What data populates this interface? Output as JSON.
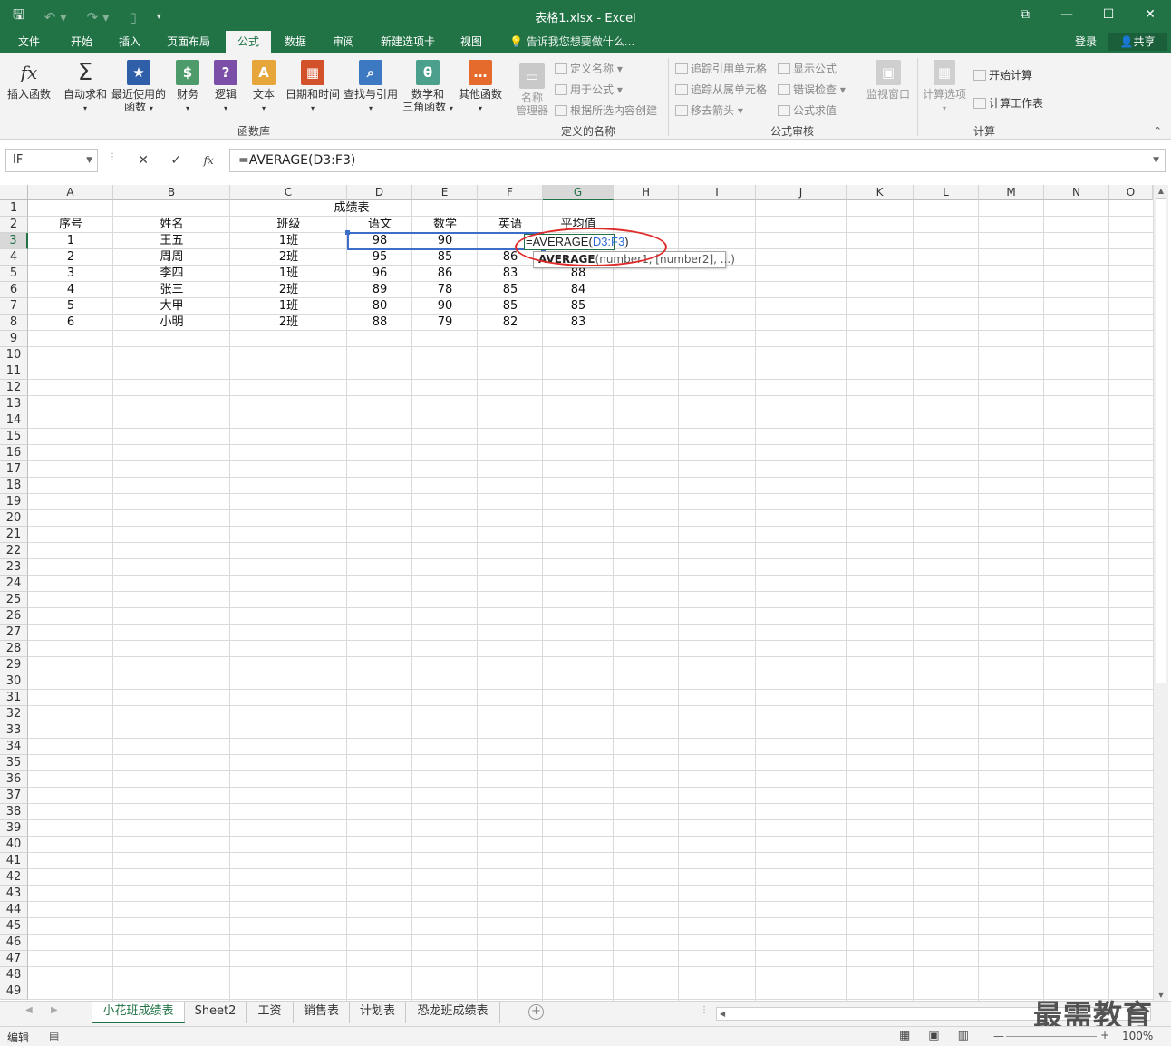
{
  "window": {
    "title": "表格1.xlsx - Excel",
    "qat_icons": [
      "save-icon",
      "undo-icon",
      "redo-icon",
      "new-icon",
      "customize-icon"
    ]
  },
  "tabs": [
    {
      "label": "文件",
      "x": 0
    },
    {
      "label": "开始"
    },
    {
      "label": "插入"
    },
    {
      "label": "页面布局"
    },
    {
      "label": "公式",
      "active": true
    },
    {
      "label": "数据"
    },
    {
      "label": "审阅"
    },
    {
      "label": "新建选项卡"
    },
    {
      "label": "视图"
    }
  ],
  "tell_me": "告诉我您想要做什么...",
  "login": "登录",
  "share": "共享",
  "ribbon": {
    "insert_function": "插入函数",
    "autosum": "自动求和",
    "recent": "最近使用的",
    "recent2": "函数",
    "financial": "财务",
    "logical": "逻辑",
    "text": "文本",
    "datetime": "日期和时间",
    "lookup": "查找与引用",
    "math": "数学和",
    "math2": "三角函数",
    "more": "其他函数",
    "group_library": "函数库",
    "name_manager": "名称",
    "name_manager2": "管理器",
    "define_name": "定义名称",
    "use_in_formula": "用于公式",
    "create_from_selection": "根据所选内容创建",
    "group_defined_names": "定义的名称",
    "trace_precedents": "追踪引用单元格",
    "trace_dependents": "追踪从属单元格",
    "remove_arrows": "移去箭头",
    "show_formulas": "显示公式",
    "error_checking": "错误检查",
    "evaluate_formula": "公式求值",
    "group_auditing": "公式审核",
    "watch_window": "监视窗口",
    "calc_options": "计算选项",
    "calc_now": "开始计算",
    "calc_sheet": "计算工作表",
    "group_calculation": "计算"
  },
  "formula_bar": {
    "name_box": "IF",
    "formula": "=AVERAGE(D3:F3)"
  },
  "columns": [
    "A",
    "B",
    "C",
    "D",
    "E",
    "F",
    "G",
    "H",
    "I",
    "J",
    "K",
    "L",
    "M",
    "N",
    "O"
  ],
  "sheet": {
    "title": "成绩表",
    "headers": [
      "序号",
      "姓名",
      "班级",
      "语文",
      "数学",
      "英语",
      "平均值"
    ],
    "rows": [
      [
        "1",
        "王五",
        "1班",
        "98",
        "90",
        "",
        ""
      ],
      [
        "2",
        "周周",
        "2班",
        "95",
        "85",
        "86",
        ""
      ],
      [
        "3",
        "李四",
        "1班",
        "96",
        "86",
        "83",
        "88"
      ],
      [
        "4",
        "张三",
        "2班",
        "89",
        "78",
        "85",
        "84"
      ],
      [
        "5",
        "大甲",
        "1班",
        "80",
        "90",
        "85",
        "85"
      ],
      [
        "6",
        "小明",
        "2班",
        "88",
        "79",
        "82",
        "83"
      ]
    ]
  },
  "edit": {
    "prefix": "=AVERAGE(",
    "ref": "D3:F3",
    "suffix": ")",
    "tip_fn": "AVERAGE",
    "tip_args": "(number1, [number2], ...)"
  },
  "sheet_tabs": [
    "小花班成绩表",
    "Sheet2",
    "工资",
    "销售表",
    "计划表",
    "恐龙班成绩表"
  ],
  "status": {
    "mode": "编辑",
    "zoom": "100%"
  },
  "watermark": "最需教育"
}
